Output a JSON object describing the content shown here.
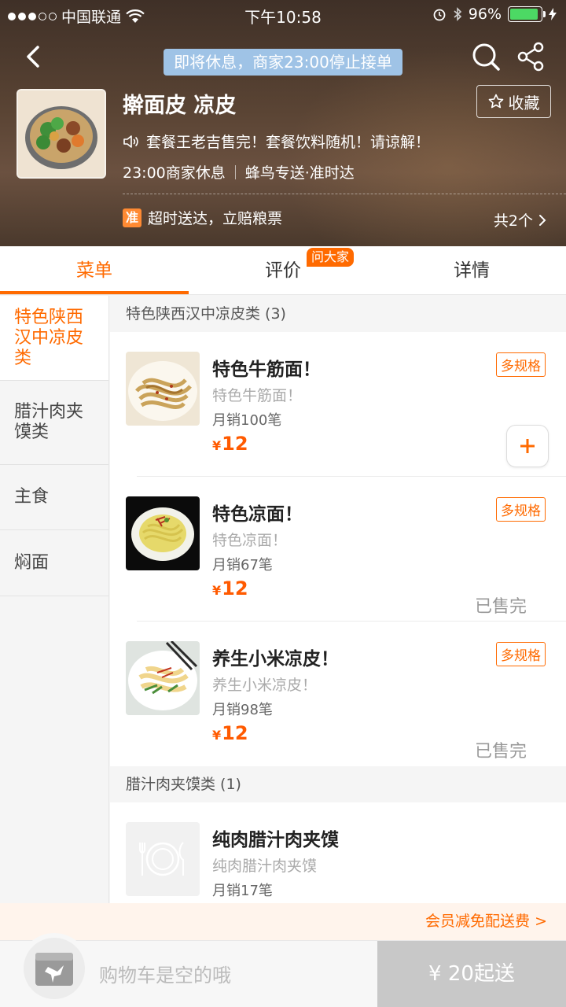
{
  "status_bar": {
    "carrier": "中国联通",
    "time": "下午10:58",
    "battery": "96%"
  },
  "header": {
    "notice": "即将休息，商家23:00停止接单",
    "shop_name": "擀面皮 凉皮",
    "favorite_label": "收藏",
    "announcement": "套餐王老吉售完！套餐饮料随机！请谅解！",
    "hours": "23:00商家休息",
    "delivery": "蜂鸟专送·准时达",
    "promo_badge": "准",
    "promo_text": "超时送达，立赔粮票",
    "promo_count": "共2个"
  },
  "tabs": [
    {
      "label": "菜单"
    },
    {
      "label": "评价",
      "badge": "问大家"
    },
    {
      "label": "详情"
    }
  ],
  "sidebar": {
    "items": [
      {
        "label": "特色陕西汉中凉皮类"
      },
      {
        "label": "腊汁肉夹馍类"
      },
      {
        "label": "主食"
      },
      {
        "label": "焖面"
      }
    ]
  },
  "menu": {
    "category1": "特色陕西汉中凉皮类 (3)",
    "category2": "腊汁肉夹馍类 (1)",
    "items": [
      {
        "name": "特色牛筋面！",
        "desc": "特色牛筋面！",
        "sales": "月销100笔",
        "yen": "¥",
        "price": "12",
        "spec": "多规格"
      },
      {
        "name": "特色凉面！",
        "desc": "特色凉面！",
        "sales": "月销67笔",
        "yen": "¥",
        "price": "12",
        "spec": "多规格",
        "status": "已售完"
      },
      {
        "name": "养生小米凉皮！",
        "desc": "养生小米凉皮！",
        "sales": "月销98笔",
        "yen": "¥",
        "price": "12",
        "spec": "多规格",
        "status": "已售完"
      },
      {
        "name": "纯肉腊汁肉夹馍",
        "desc": "纯肉腊汁肉夹馍",
        "sales": "月销17笔"
      }
    ]
  },
  "member_bar": "会员减免配送费 >",
  "cart": {
    "empty_text": "购物车是空的哦",
    "checkout": "¥ 20起送"
  },
  "colors": {
    "accent": "#ff6a00",
    "notice_bg": "#9fc3e6",
    "checkout_bg": "#c8c8c8"
  }
}
